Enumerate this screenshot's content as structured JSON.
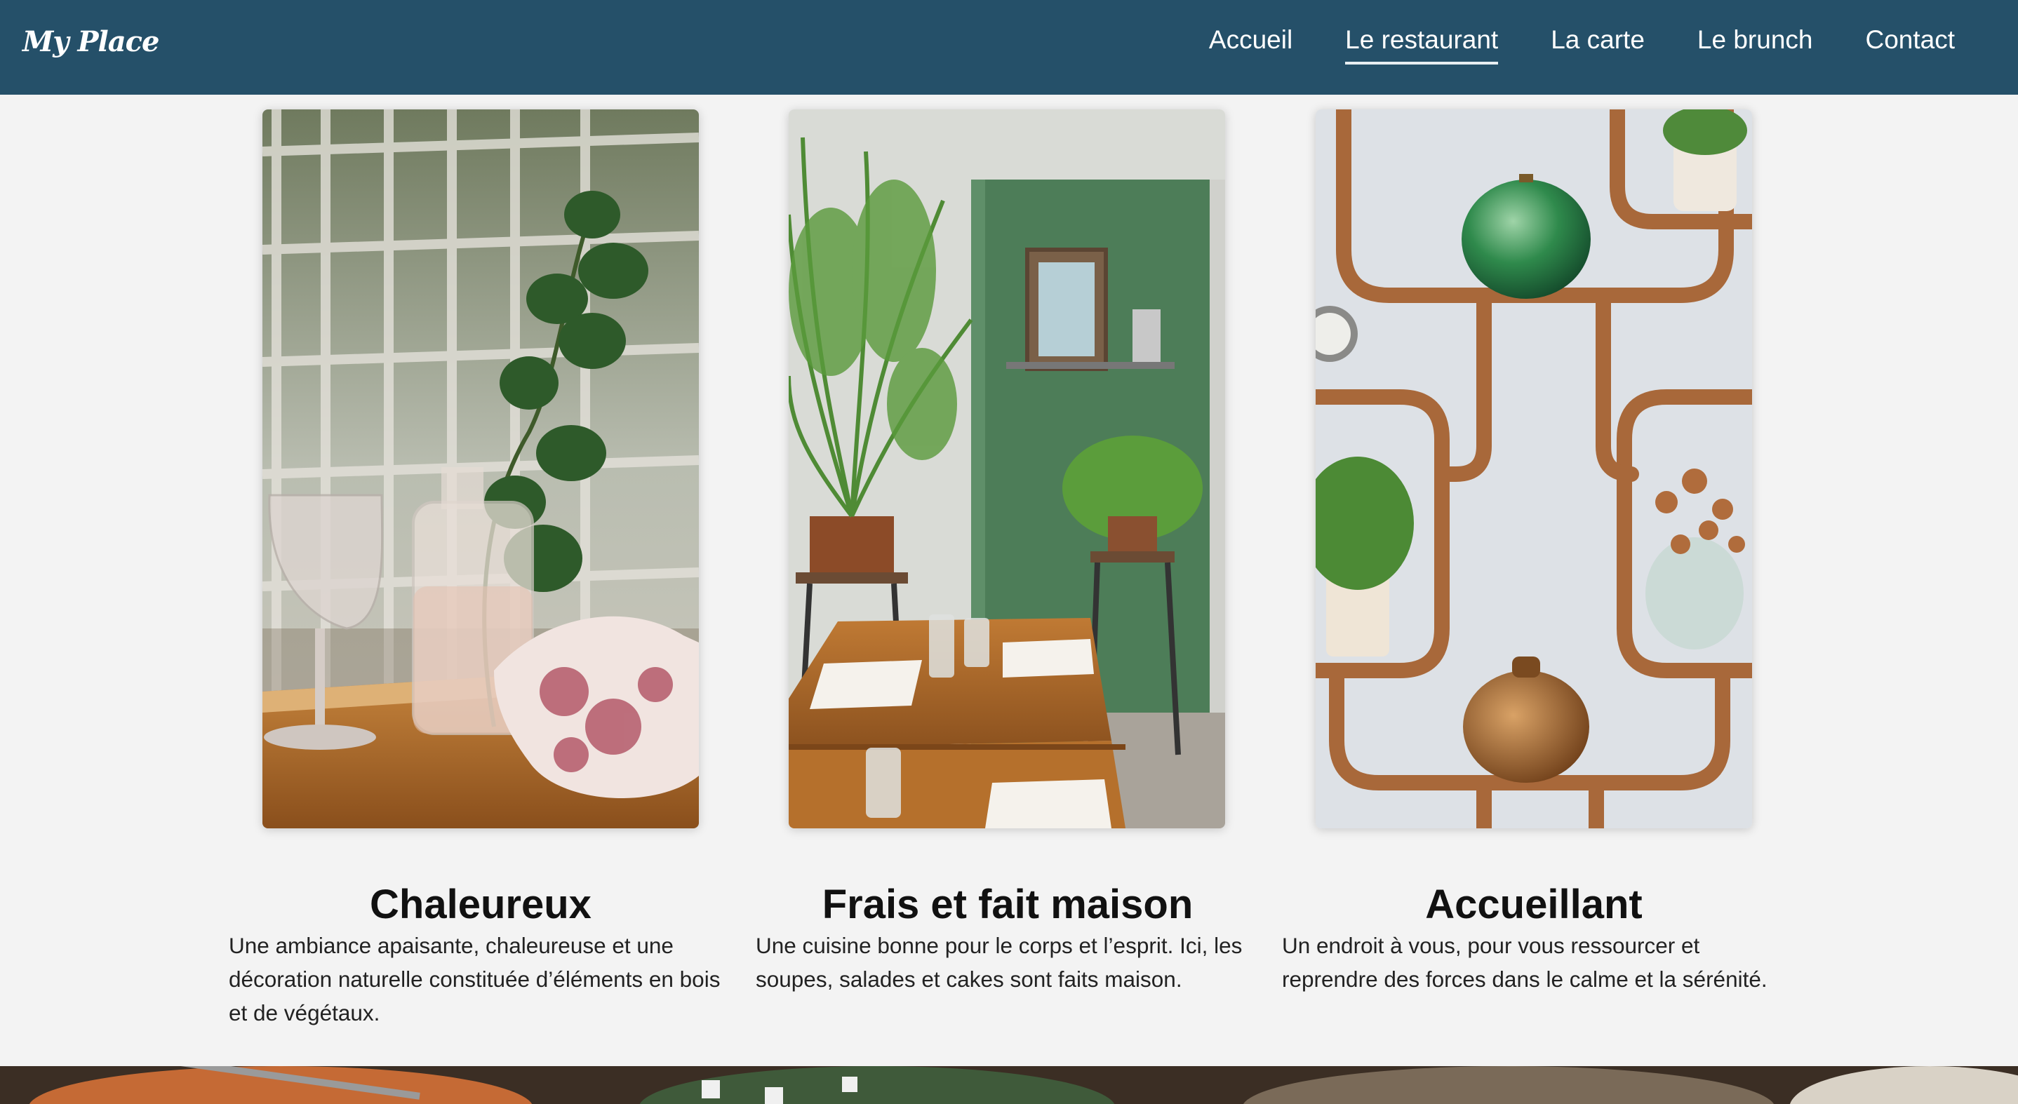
{
  "header": {
    "brand": "My Place",
    "nav": [
      {
        "label": "Accueil",
        "active": false
      },
      {
        "label": "Le restaurant",
        "active": true
      },
      {
        "label": "La carte",
        "active": false
      },
      {
        "label": "Le brunch",
        "active": false
      },
      {
        "label": "Contact",
        "active": false
      }
    ]
  },
  "features": [
    {
      "title": "Chaleureux",
      "text": "Une ambiance apaisante, chaleureuse et une décoration naturelle constituée d’éléments en bois et de végétaux."
    },
    {
      "title": "Frais et fait maison",
      "text": "Une cuisine bonne pour le corps et l’esprit. Ici, les soupes, salades et cakes sont faits maison."
    },
    {
      "title": "Accueillant",
      "text": "Un endroit à vous, pour vous ressourcer et reprendre des forces dans le calme et la sérénité."
    }
  ],
  "colors": {
    "header_bg": "#255069",
    "page_bg": "#f3f3f3"
  }
}
